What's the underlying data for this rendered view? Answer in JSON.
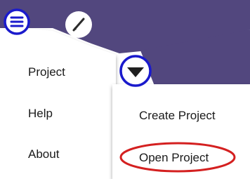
{
  "menu": {
    "items": [
      {
        "label": "Project"
      },
      {
        "label": "Help"
      },
      {
        "label": "About"
      }
    ]
  },
  "submenu": {
    "items": [
      {
        "label": "Create Project"
      },
      {
        "label": "Open Project"
      }
    ]
  },
  "colors": {
    "header_background": "#52477e",
    "annotation_circle": "#1a1acc",
    "annotation_ellipse": "#d42020",
    "text": "#1a1a1a"
  },
  "icons": {
    "menu_toggle": "hamburger-icon",
    "edit": "pencil-icon",
    "dropdown": "triangle-down-icon"
  }
}
